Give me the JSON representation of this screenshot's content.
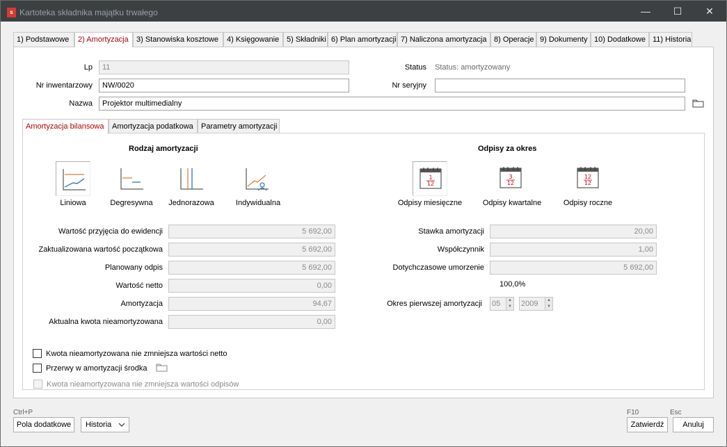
{
  "window": {
    "title": "Kartoteka składnika majątku trwałego",
    "logo_letter": "s",
    "minimize": "—",
    "maximize": "☐",
    "close": "✕"
  },
  "tabs": [
    {
      "label": "1) Podstawowe",
      "active": false
    },
    {
      "label": "2) Amortyzacja",
      "active": true
    },
    {
      "label": "3) Stanowiska kosztowe",
      "active": false
    },
    {
      "label": "4) Księgowanie",
      "active": false
    },
    {
      "label": "5) Składniki",
      "active": false
    },
    {
      "label": "6) Plan amortyzacji",
      "active": false
    },
    {
      "label": "7) Naliczona amortyzacja",
      "active": false
    },
    {
      "label": "8) Operacje",
      "active": false
    },
    {
      "label": "9) Dokumenty",
      "active": false
    },
    {
      "label": "10) Dodatkowe",
      "active": false
    },
    {
      "label": "11) Historia",
      "active": false
    }
  ],
  "header": {
    "lp_label": "Lp",
    "lp_value": "11",
    "status_label": "Status",
    "status_value": "Status: amortyzowany",
    "inv_label": "Nr inwentarzowy",
    "inv_value": "NW/0020",
    "serial_label": "Nr seryjny",
    "serial_value": "",
    "name_label": "Nazwa",
    "name_value": "Projektor multimedialny"
  },
  "subtabs": [
    {
      "label": "Amortyzacja bilansowa",
      "active": true
    },
    {
      "label": "Amortyzacja podatkowa",
      "active": false
    },
    {
      "label": "Parametry amortyzacji",
      "active": false
    }
  ],
  "depreciation_type": {
    "title": "Rodzaj amortyzacji",
    "options": [
      "Liniowa",
      "Degresywna",
      "Jednorazowa",
      "Indywidualna"
    ],
    "selected": "Liniowa"
  },
  "writeoffs": {
    "title": "Odpisy za okres",
    "options": [
      "Odpisy miesięczne",
      "Odpisy kwartalne",
      "Odpisy roczne"
    ],
    "selected": "Odpisy miesięczne",
    "fractions": [
      [
        "1",
        "12"
      ],
      [
        "3",
        "12"
      ],
      [
        "12",
        "12"
      ]
    ]
  },
  "left_fields": [
    {
      "label": "Wartość przyjęcia do ewidencji",
      "value": "5 692,00"
    },
    {
      "label": "Zaktualizowana wartość początkowa",
      "value": "5 692,00"
    },
    {
      "label": "Planowany odpis",
      "value": "5 692,00"
    },
    {
      "label": "Wartość netto",
      "value": "0,00"
    },
    {
      "label": "Amortyzacja",
      "value": "94,67"
    },
    {
      "label": "Aktualna kwota nieamortyzowana",
      "value": "0,00"
    }
  ],
  "right_fields": [
    {
      "label": "Stawka amortyzacji",
      "value": "20,00"
    },
    {
      "label": "Współczynnik",
      "value": "1,00"
    },
    {
      "label": "Dotychczasowe umorzenie",
      "value": "5 692,00"
    }
  ],
  "percent": "100,0%",
  "first_period": {
    "label": "Okres pierwszej amortyzacji",
    "month": "05",
    "year": "2009"
  },
  "checkboxes": [
    {
      "label": "Kwota nieamortyzowana nie zmniejsza wartości odpisów",
      "checked": false,
      "disabled": true
    },
    {
      "label": "Kwota nieamortyzowana nie zmniejsza wartości netto",
      "checked": false,
      "disabled": false
    },
    {
      "label": "Przerwy w amortyzacji środka",
      "checked": false,
      "disabled": false
    }
  ],
  "footer": {
    "shortcut_left": "Ctrl+P",
    "extra_fields_button": "Pola dodatkowe",
    "history_button": "Historia",
    "shortcut_confirm": "F10",
    "confirm_button": "Zatwierdź",
    "shortcut_cancel": "Esc",
    "cancel_button": "Anuluj"
  },
  "colors": {
    "accent_red": "#b00000",
    "chart_orange": "#e07a2e",
    "chart_blue": "#3a7fc2",
    "titlebar": "#3c4043"
  }
}
